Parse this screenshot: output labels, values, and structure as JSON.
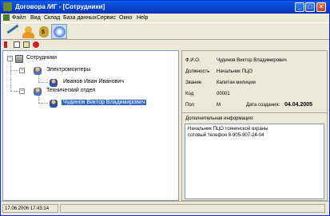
{
  "window": {
    "title": "Договора /ИГ - [Сотрудники]",
    "controls": {
      "minimize": "_",
      "maximize": "□",
      "close": "×"
    }
  },
  "menu": {
    "items": [
      "Файл",
      "Вид",
      "Склад",
      "База данных",
      "Сервис",
      "Окно",
      "Help"
    ]
  },
  "toolbar": {
    "buttons": [
      "wrench-icon",
      "people-icon",
      "money-bag-icon",
      "disk-icon"
    ],
    "money_glyph": "$"
  },
  "toolbar2": {
    "buttons": [
      "flag-icon",
      "edit-icon",
      "edit2-icon",
      "delete-icon"
    ]
  },
  "tree": {
    "root": {
      "label": "Сотрудники",
      "expander": "−"
    },
    "groups": [
      {
        "label": "Электромонтеры",
        "expander": "−",
        "children": [
          {
            "label": "Иванов Иван Иванович"
          }
        ]
      },
      {
        "label": "Технический отдел",
        "expander": "−",
        "children": [
          {
            "label": "Чудинов Виктор Владимирович",
            "selected": true
          }
        ]
      }
    ]
  },
  "details": {
    "fio_label": "Ф.И.О.",
    "fio_value": "Чудинов Виктор Владимирович",
    "position_label": "Должность",
    "position_value": "Начальник ПЦО",
    "rank_label": "Звание",
    "rank_value": "Капитан милиции",
    "code_label": "Код",
    "code_value": "00001",
    "sex_label": "Пол",
    "sex_value": "М",
    "created_label": "Дата создания:",
    "created_value": "04.04.2005",
    "notes_label": "Дополнительная информация:",
    "notes_lines": [
      "Начальник ПЦО тоянинской охраны",
      "сотовый телефон 8-905-907-24-04"
    ]
  },
  "status": {
    "datetime": "17.06.2006 17:43:14"
  }
}
